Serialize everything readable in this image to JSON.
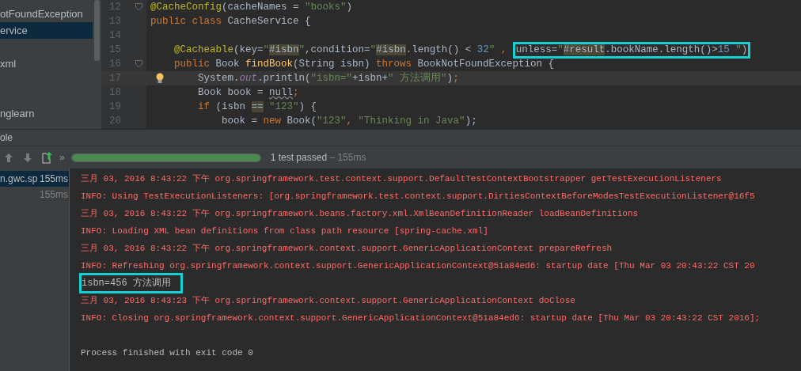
{
  "project_tree": {
    "items": [
      {
        "kind": "file",
        "label": "otFoundException",
        "selected": false
      },
      {
        "kind": "file",
        "label": "ervice",
        "selected": true
      },
      {
        "kind": "spacer"
      },
      {
        "kind": "file",
        "label": "xml",
        "selected": false
      },
      {
        "kind": "spacer"
      },
      {
        "kind": "spacer"
      },
      {
        "kind": "file",
        "label": "nglearn",
        "selected": false
      }
    ]
  },
  "editor": {
    "lines": [
      {
        "number": "12",
        "fold": true,
        "current": false,
        "bulb": false,
        "tokens": [
          {
            "kind": "annotation",
            "text": "@CacheConfig"
          },
          {
            "kind": "plain",
            "text": "(cacheNames = "
          },
          {
            "kind": "string",
            "text": "\"books\""
          },
          {
            "kind": "plain",
            "text": ")"
          }
        ]
      },
      {
        "number": "13",
        "fold": false,
        "current": false,
        "bulb": false,
        "tokens": [
          {
            "kind": "keyword",
            "text": "public class "
          },
          {
            "kind": "plain",
            "text": "CacheService {"
          }
        ]
      },
      {
        "number": "14",
        "fold": false,
        "current": false,
        "bulb": false
      },
      {
        "number": "15",
        "fold": false,
        "current": false,
        "bulb": false,
        "tokens": [
          {
            "kind": "annotation",
            "text": "    @Cacheable"
          },
          {
            "kind": "plain",
            "text": "(key="
          },
          {
            "kind": "string",
            "text": "\""
          },
          {
            "kind": "match",
            "text": "#isbn"
          },
          {
            "kind": "string",
            "text": "\""
          },
          {
            "kind": "plain",
            "text": ",condition="
          },
          {
            "kind": "string",
            "text": "\""
          },
          {
            "kind": "match",
            "text": "#isbn"
          },
          {
            "kind": "plain",
            "text": ".length() < "
          },
          {
            "kind": "number",
            "text": "32"
          },
          {
            "kind": "string",
            "text": "\" "
          },
          {
            "kind": "keyword",
            "text": ", "
          },
          {
            "kind": "outlined",
            "tokens": [
              {
                "kind": "plain",
                "text": "unless="
              },
              {
                "kind": "string",
                "text": "\""
              },
              {
                "kind": "match",
                "text": "#result"
              },
              {
                "kind": "plain",
                "text": ".bookName.length()>"
              },
              {
                "kind": "number",
                "text": "15 "
              },
              {
                "kind": "string",
                "text": "\""
              },
              {
                "kind": "plain",
                "text": ")"
              }
            ]
          }
        ]
      },
      {
        "number": "16",
        "fold": true,
        "current": false,
        "bulb": false,
        "tokens": [
          {
            "kind": "keyword",
            "text": "    public "
          },
          {
            "kind": "plain",
            "text": "Book "
          },
          {
            "kind": "method",
            "text": "findBook"
          },
          {
            "kind": "plain",
            "text": "(String isbn) "
          },
          {
            "kind": "keyword",
            "text": "throws "
          },
          {
            "kind": "plain",
            "text": "BookNotFoundException {"
          }
        ]
      },
      {
        "number": "17",
        "fold": false,
        "current": true,
        "bulb": true,
        "tokens": [
          {
            "kind": "plain",
            "text": "        System."
          },
          {
            "kind": "field",
            "text": "out"
          },
          {
            "kind": "plain",
            "text": ".println("
          },
          {
            "kind": "string",
            "text": "\"isbn=\""
          },
          {
            "kind": "plain",
            "text": "+isbn+"
          },
          {
            "kind": "string",
            "text": "\" 方法调用\""
          },
          {
            "kind": "plain",
            "text": ")"
          },
          {
            "kind": "keyword",
            "text": ";"
          }
        ]
      },
      {
        "number": "18",
        "fold": false,
        "current": false,
        "bulb": false,
        "tokens": [
          {
            "kind": "plain",
            "text": "        Book book = "
          },
          {
            "kind": "warning",
            "text": "null"
          },
          {
            "kind": "keyword",
            "text": ";"
          }
        ]
      },
      {
        "number": "19",
        "fold": false,
        "current": false,
        "bulb": false,
        "tokens": [
          {
            "kind": "keyword",
            "text": "        if "
          },
          {
            "kind": "plain",
            "text": "(isbn "
          },
          {
            "kind": "match",
            "text": "=="
          },
          {
            "kind": "string",
            "text": " \"123\""
          },
          {
            "kind": "plain",
            "text": ") {"
          }
        ]
      },
      {
        "number": "20",
        "fold": false,
        "current": false,
        "bulb": false,
        "tokens": [
          {
            "kind": "plain",
            "text": "            book = "
          },
          {
            "kind": "keyword",
            "text": "new "
          },
          {
            "kind": "plain",
            "text": "Book("
          },
          {
            "kind": "string",
            "text": "\"123\""
          },
          {
            "kind": "keyword",
            "text": ", "
          },
          {
            "kind": "string",
            "text": "\"Thinking in Java\""
          },
          {
            "kind": "plain",
            "text": ");"
          }
        ]
      }
    ]
  },
  "tool_window": {
    "title": "ole",
    "toolbar": {
      "more": "»",
      "progress": {
        "level": 1
      },
      "status": "1 test passed",
      "duration": " – 155ms"
    },
    "tests": [
      {
        "label": "n.gwc.sp",
        "time": "155ms",
        "selected": true
      },
      {
        "time": "155ms",
        "selected": false
      }
    ],
    "console": [
      {
        "kind": "error",
        "text": "三月 03, 2016 8:43:22 下午 org.springframework.test.context.support.DefaultTestContextBootstrapper getTestExecutionListeners"
      },
      {
        "kind": "error",
        "text": "INFO: Using TestExecutionListeners: [org.springframework.test.context.support.DirtiesContextBeforeModesTestExecutionListener@16f5"
      },
      {
        "kind": "error",
        "text": "三月 03, 2016 8:43:22 下午 org.springframework.beans.factory.xml.XmlBeanDefinitionReader loadBeanDefinitions"
      },
      {
        "kind": "error",
        "text": "INFO: Loading XML bean definitions from class path resource [spring-cache.xml]"
      },
      {
        "kind": "error",
        "text": "三月 03, 2016 8:43:22 下午 org.springframework.context.support.GenericApplicationContext prepareRefresh"
      },
      {
        "kind": "error",
        "text": "INFO: Refreshing org.springframework.context.support.GenericApplicationContext@51a84ed6: startup date [Thu Mar 03 20:43:22 CST 20"
      },
      {
        "kind": "outlined",
        "text": "isbn=456 方法调用"
      },
      {
        "kind": "error",
        "text": "三月 03, 2016 8:43:23 下午 org.springframework.context.support.GenericApplicationContext doClose"
      },
      {
        "kind": "error",
        "text": "INFO: Closing org.springframework.context.support.GenericApplicationContext@51a84ed6: startup date [Thu Mar 03 20:43:22 CST 2016];"
      },
      {
        "kind": "blank"
      },
      {
        "kind": "output",
        "text": "Process finished with exit code 0"
      }
    ]
  }
}
